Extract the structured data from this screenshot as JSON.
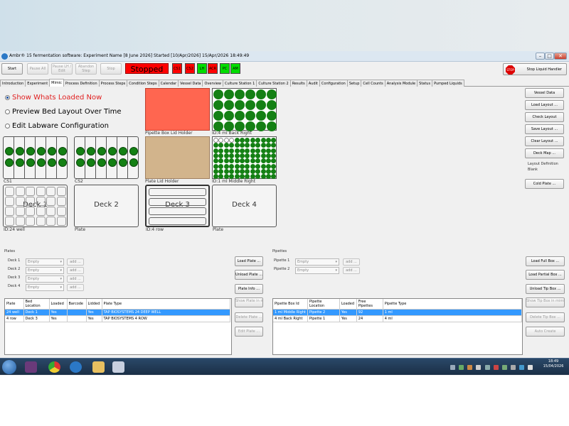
{
  "window": {
    "title": "Ambr® 15 fermentation software: Experiment Name [8 June 2026] Started [10/Apr/2026] 15/Apr/2026 18:49:49"
  },
  "toolbar": {
    "start": "Start",
    "pause_all": "Pause All",
    "pause_lh_edit": "Pause LH / Edit",
    "abandon_step": "Abandon Step",
    "stop": "Stop",
    "status": "Stopped",
    "indicators": [
      {
        "label": "CS1",
        "color": "#ff0000"
      },
      {
        "label": "CS2",
        "color": "#ff0000"
      },
      {
        "label": "LH",
        "color": "#00dd00"
      },
      {
        "label": "ACR",
        "color": "#ff0000"
      },
      {
        "label": "PC",
        "color": "#00dd00"
      },
      {
        "label": "AM",
        "color": "#00dd00"
      }
    ],
    "stop_liquid_handler": "Stop Liquid Handler",
    "stop_icon_text": "STOP"
  },
  "tabs": [
    "Introduction",
    "Experiment",
    "Mimic",
    "Process Definition",
    "Process Steps",
    "Condition Steps",
    "Calendar",
    "Vessel Data",
    "Overview",
    "Culture Station 1",
    "Culture Station 2",
    "Results",
    "Audit",
    "Configuration",
    "Setup",
    "Cell Counts",
    "Analysis Module",
    "Status",
    "Pumped Liquids"
  ],
  "active_tab": "Mimic",
  "mimic": {
    "radios": [
      {
        "label": "Show Whats Loaded Now",
        "selected": true
      },
      {
        "label": "Preview Bed Layout Over Time",
        "selected": false
      },
      {
        "label": "Edit Labware Configuration",
        "selected": false
      }
    ],
    "labels": {
      "pipette_box_lid": "Pipette Box Lid Holder",
      "plate_lid": "Plate Lid Holder",
      "ml4_back_right": "ID:4 ml Back Right",
      "ml1_middle_right": "ID:1 ml Middle Right",
      "cs1": "CS1",
      "cs2": "CS2",
      "id_24well": "ID:24 well",
      "plate1": "Plate",
      "id_4row": "ID:4 row",
      "plate2": "Plate"
    },
    "decks": [
      "Deck 1",
      "Deck 2",
      "Deck 3",
      "Deck 4"
    ],
    "right_buttons": [
      "Vessel Data",
      "Load Layout ...",
      "Check Layout",
      "Save Layout ...",
      "Clear Layout ...",
      "Deck Map ..."
    ],
    "layout_definition_label": "Layout Definition",
    "layout_definition_value": "Blank",
    "cold_plate": "Cold Plate ..."
  },
  "plates": {
    "heading": "Plates",
    "rows": [
      {
        "label": "Deck 1",
        "value": "Empty"
      },
      {
        "label": "Deck 2",
        "value": "Empty"
      },
      {
        "label": "Deck 3",
        "value": "Empty"
      },
      {
        "label": "Deck 4",
        "value": "Empty"
      }
    ],
    "add": "add ...",
    "buttons": [
      "Load Plate ...",
      "Unload Plate ...",
      "Plate Info ...",
      "Show Plate in mimic",
      "Delete Plate ...",
      "Edit Plate ..."
    ],
    "columns": [
      "Plate",
      "Bed Location",
      "Loaded",
      "Barcode",
      "Lidded",
      "Plate Type"
    ],
    "table": [
      [
        "24 well",
        "Deck 1",
        "Yes",
        "",
        "Yes",
        "TAP BIOSYSTEMS 24 DEEP WELL"
      ],
      [
        "4 row",
        "Deck 3",
        "Yes",
        "",
        "Yes",
        "TAP BIOSYSTEMS 4 ROW"
      ]
    ]
  },
  "pipettes": {
    "heading": "Pipettes",
    "rows": [
      {
        "label": "Pipette 1",
        "value": "Empty"
      },
      {
        "label": "Pipette 2",
        "value": "Empty"
      }
    ],
    "add": "add ...",
    "buttons": [
      "Load Full Box ...",
      "Load Partial Box ...",
      "Unload Tip Box ...",
      "Show Tip Box in mimic",
      "Delete Tip Box ...",
      "Auto Create"
    ],
    "columns": [
      "Pipette Box Id",
      "Pipette Location",
      "Loaded",
      "Free Pipettes",
      "Pipette Type"
    ],
    "table": [
      [
        "1 ml Middle Right",
        "Pipette 2",
        "Yes",
        "92",
        "1 ml"
      ],
      [
        "4 ml Back Right",
        "Pipette 1",
        "Yes",
        "24",
        "4 ml"
      ]
    ]
  },
  "taskbar": {
    "time": "18:49",
    "date": "15/04/2026"
  }
}
